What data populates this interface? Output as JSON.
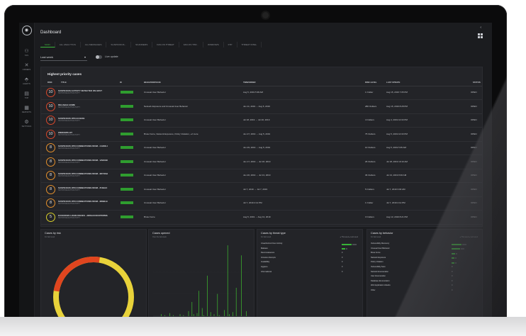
{
  "sidebar": {
    "logo_label": "",
    "items": [
      {
        "label": "TAS",
        "icon": "person-icon"
      },
      {
        "label": "ORDERS",
        "icon": "crossed-swords-icon"
      },
      {
        "label": "ALERTS",
        "icon": "shield-icon"
      },
      {
        "label": "TOP",
        "icon": "document-icon"
      },
      {
        "label": "REPORTS",
        "icon": "grid-icon"
      },
      {
        "label": "SETTINGS",
        "icon": "gear-icon"
      }
    ]
  },
  "header": {
    "title": "Dashboard"
  },
  "tabs": [
    "MAIN",
    "ALL ANALYTICS",
    "ALL MESSAGES",
    "SUSPICIOUS...",
    "SCANNERS",
    "FAN-OS THREAT",
    "FAN-OS THR...",
    "WINDOWS",
    "FTP",
    "THREAT INTEL"
  ],
  "filter": {
    "period": "Last week",
    "live_update": "Live update"
  },
  "cases": {
    "title": "Highest priority cases",
    "columns": [
      "RISK",
      "TITLE",
      "ID",
      "BEHAVIOR/ISSUE",
      "TIME/ORDER",
      "RISK LEVEL",
      "LAST UPDATE",
      "STATUS"
    ],
    "rows": [
      {
        "risk": "10",
        "level": "red",
        "title": "SUSPICIOUS ACTIVITY DETECTED ON HOST",
        "sub": "SWITCHING/AUTH/ACTIVITY",
        "behavior": "Unusual User Behavior",
        "range": "Aug 5, 2019 5:38 AM",
        "count": "1 Outlier",
        "update": "Aug 15, 2019 7:05 PM",
        "status": "OPEN"
      },
      {
        "risk": "10",
        "level": "red",
        "title": "RELIABLE HOME",
        "sub": "SWITCHING/AUTH/ACTIVITY",
        "behavior": "Network Exposure and Unusual User Behavior",
        "range": "Jun 11, 2019 → Aug 5, 2019",
        "count": "280 Outliers",
        "update": "Aug 15, 2019 8:28 PM",
        "status": "OPEN"
      },
      {
        "risk": "10",
        "level": "red",
        "title": "SUSPICIOUS VPN ACCESS",
        "sub": "SWITCHING/AUTH/ACTIVITY",
        "behavior": "Unusual User Behavior",
        "range": "Jul 18, 2019 → Jul 20, 2019",
        "count": "4 Outliers",
        "update": "Aug 4, 2019 10:33 PM",
        "status": "OPEN"
      },
      {
        "risk": "10",
        "level": "red",
        "title": "WINDOWS HIT",
        "sub": "SWITCHING/AUTH/ACTIVITY",
        "behavior": "Brute Force, Network Exposure, Policy Violation, +2 more",
        "range": "Jun 27, 2019 → Aug 5, 2019",
        "count": "75 Outliers",
        "update": "Aug 5, 2019 10:33 PM",
        "status": "OPEN"
      },
      {
        "risk": "8",
        "level": "orange",
        "title": "SUSPICIOUS VPN CONNECTIONS FROM - CAROLINA - C",
        "sub": "SWITCHING/AUTH/ACTIVITY",
        "behavior": "Unusual User Behavior",
        "range": "Jun 29, 2019 → Aug 5, 2019",
        "count": "10 Outliers",
        "update": "Aug 5, 2019 5:35 AM",
        "status": "OPEN"
      },
      {
        "risk": "8",
        "level": "orange",
        "title": "SUSPICIOUS VPN CONNECTIONS FROM - VANCENT - C",
        "sub": "SWITCHING/AUTH/ACTIVITY",
        "behavior": "Unusual User Behavior",
        "range": "Jun 17, 2019 → Jul 18, 2019",
        "count": "26 Outliers",
        "update": "Jul 18, 2019 10:10 AM",
        "status": "OPEN"
      },
      {
        "risk": "8",
        "level": "orange",
        "title": "SUSPICIOUS VPN CONNECTIONS FROM - MIYOSHI - CL",
        "sub": "SWITCHING/AUTH/ACTIVITY",
        "behavior": "Unusual User Behavior",
        "range": "Jun 26, 2019 → Jul 13, 2019",
        "count": "36 Outliers",
        "update": "Jul 13, 2019 8:36 AM",
        "status": "OPEN"
      },
      {
        "risk": "8",
        "level": "orange",
        "title": "SUSPICIOUS VPN CONNECTIONS FROM - PUBLIC - YO",
        "sub": "SWITCHING/AUTH/ACTIVITY",
        "behavior": "Unusual User Behavior",
        "range": "Jul 7, 2019 → Jul 7, 2019",
        "count": "5 Outliers",
        "update": "Jul 7, 2019 3:00 AM",
        "status": "OPEN"
      },
      {
        "risk": "8",
        "level": "orange",
        "title": "SUSPICIOUS VPN CONNECTIONS FROM - MOBILE - YO",
        "sub": "SWITCHING/AUTH/ACTIVITY",
        "behavior": "Unusual User Behavior",
        "range": "Jul 7, 2019 2:12 PM",
        "count": "1 Outlier",
        "update": "Jul 7, 2019 2:12 PM",
        "status": "OPEN"
      },
      {
        "risk": "5",
        "level": "yellow",
        "title": "EXCESSIVE LOGIN ISSUES - AWSACCOUNTOPERATOR &",
        "sub": "SWITCHING/AUTH/ACTIVITY",
        "behavior": "Brute Force",
        "range": "Aug 5, 2019 → Aug 13, 2019",
        "count": "3 Outliers",
        "update": "Aug 13, 2019 8:21 PM",
        "status": "OPEN"
      }
    ]
  },
  "risk_panel": {
    "title": "Cases by risk",
    "sub": "For last week",
    "ring_values": [
      {
        "label": "high",
        "value": 25,
        "color": "#e0451f"
      },
      {
        "label": "medium",
        "value": 75,
        "color": "#e8d23a"
      }
    ]
  },
  "opened_panel": {
    "title": "Cases opened",
    "sub": "Over the last week",
    "bars": [
      0,
      0,
      0,
      0,
      2,
      0,
      1,
      0,
      0,
      3,
      0,
      1,
      0,
      0,
      0,
      2,
      0,
      1,
      0,
      0,
      5,
      0,
      14,
      2,
      0,
      3,
      25,
      0,
      8,
      1,
      0,
      40,
      0,
      4,
      0,
      2,
      0,
      22,
      1,
      0,
      0,
      6,
      0,
      70,
      2,
      0,
      4,
      0,
      28,
      0,
      0,
      60,
      0,
      0,
      5
    ]
  },
  "threat_panel": {
    "title": "Cases by threat type",
    "sub": "For last week",
    "legend": "● This week  ● Last week",
    "items": [
      {
        "label": "Unauthorized User Activity",
        "val": "999",
        "frac": 0.9
      },
      {
        "label": "Malware",
        "val": "27",
        "frac": 0.35
      },
      {
        "label": "Reconnaissance",
        "val": "0",
        "frac": 0
      },
      {
        "label": "Intrusion Attempts",
        "val": "0",
        "frac": 0
      },
      {
        "label": "Availability",
        "val": "0",
        "frac": 0
      },
      {
        "label": "Hygiene",
        "val": "0",
        "frac": 0
      },
      {
        "label": "Informational",
        "val": "0",
        "frac": 0
      }
    ]
  },
  "behavior_panel": {
    "title": "Cases by behavior",
    "sub": "For last week",
    "legend": "● This week  ● Last week",
    "items": [
      {
        "label": "Vulnerability Discovery",
        "val": "299",
        "frac": 0.9
      },
      {
        "label": "Unusual User Behavior",
        "val": "229",
        "frac": 0.8
      },
      {
        "label": "Brute Force",
        "val": "28",
        "frac": 0.3
      },
      {
        "label": "Network Exposure",
        "val": "21",
        "frac": 0.25
      },
      {
        "label": "Policy Violation",
        "val": "24",
        "frac": 0.27
      },
      {
        "label": "Vulnerability Scan",
        "val": "0",
        "frac": 0
      },
      {
        "label": "Network Enumeration",
        "val": "0",
        "frac": 0
      },
      {
        "label": "User Enumeration",
        "val": "0",
        "frac": 0
      },
      {
        "label": "Database Enumeration",
        "val": "0",
        "frac": 0
      },
      {
        "label": "Web Application Attacks",
        "val": "0",
        "frac": 0
      },
      {
        "label": "Other",
        "val": "0",
        "frac": 0
      }
    ]
  },
  "colors": {
    "accent": "#3db93d",
    "red": "#d9482b",
    "orange": "#e38f2c",
    "yellow": "#d8cf2b",
    "screen_bg": "#1b1c1f"
  }
}
